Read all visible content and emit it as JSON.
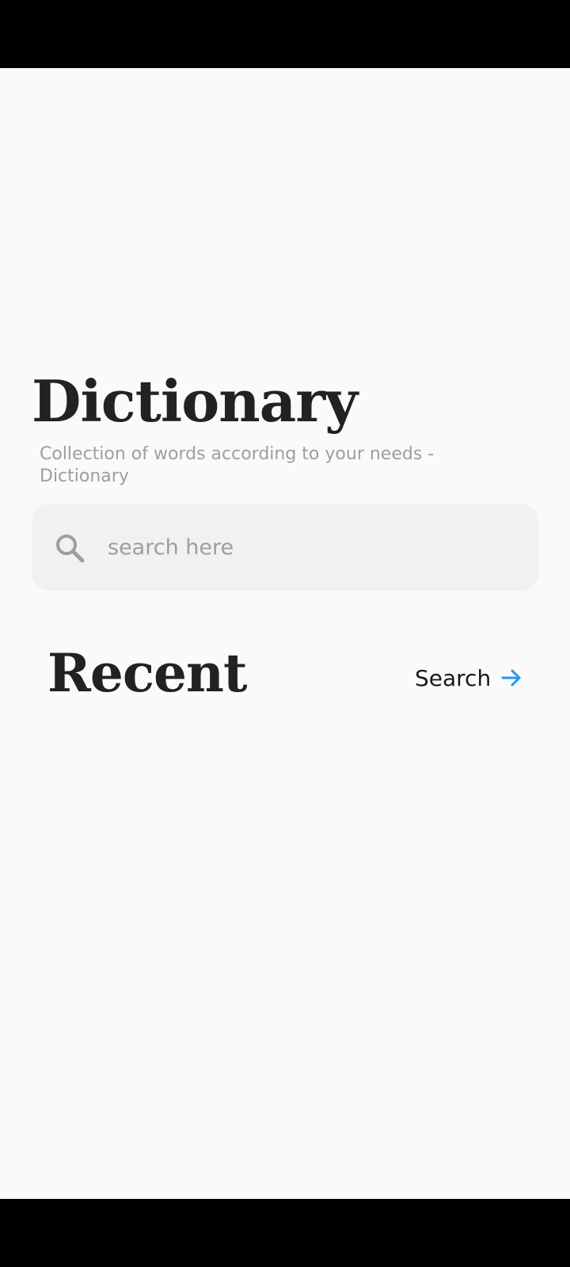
{
  "header": {
    "title": "Dictionary",
    "subtitle": "Collection of words according to your needs - Dictionary"
  },
  "search": {
    "placeholder": "search here",
    "value": "",
    "icon": "search-icon"
  },
  "recent": {
    "title": "Recent",
    "link_label": "Search",
    "link_icon": "arrow-right-icon"
  },
  "colors": {
    "background": "#fafafa",
    "title_text": "#222222",
    "subtitle_text": "#9e9e9e",
    "search_box": "#f1f1f1",
    "accent": "#2196f3",
    "system_bars": "#000000"
  }
}
